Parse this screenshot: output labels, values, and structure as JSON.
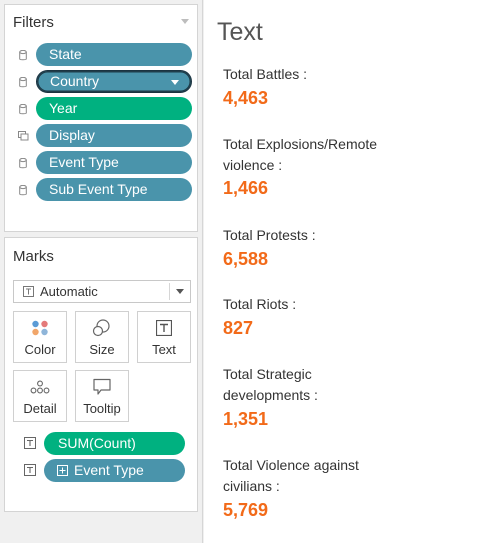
{
  "filters": {
    "title": "Filters",
    "items": [
      {
        "label": "State",
        "color": "blue",
        "icon": "database-icon"
      },
      {
        "label": "Country",
        "color": "blue",
        "icon": "database-icon",
        "selected": true
      },
      {
        "label": "Year",
        "color": "green",
        "icon": "database-icon"
      },
      {
        "label": "Display",
        "color": "blue",
        "icon": "set-icon"
      },
      {
        "label": "Event Type",
        "color": "blue",
        "icon": "database-icon"
      },
      {
        "label": "Sub Event Type",
        "color": "blue",
        "icon": "database-icon"
      }
    ]
  },
  "marks": {
    "title": "Marks",
    "mark_type": "Automatic",
    "buttons": [
      {
        "label": "Color",
        "icon": "color-dots-icon"
      },
      {
        "label": "Size",
        "icon": "size-circles-icon"
      },
      {
        "label": "Text",
        "icon": "text-box-icon"
      },
      {
        "label": "Detail",
        "icon": "detail-dots-icon"
      },
      {
        "label": "Tooltip",
        "icon": "tooltip-bubble-icon"
      }
    ],
    "shelf": [
      {
        "label": "SUM(Count)",
        "color": "green",
        "icon": "text-box-icon"
      },
      {
        "label": "Event Type",
        "color": "blue",
        "icon": "text-box-icon",
        "expandable": true
      }
    ]
  },
  "sheet": {
    "title": "Text",
    "stats": [
      {
        "label": "Total Battles :",
        "value": "4,463"
      },
      {
        "label": "Total Explosions/Remote violence :",
        "value": "1,466"
      },
      {
        "label": "Total Protests :",
        "value": "6,588"
      },
      {
        "label": "Total Riots :",
        "value": "827"
      },
      {
        "label": "Total Strategic developments :",
        "value": "1,351"
      },
      {
        "label": "Total Violence against civilians :",
        "value": "5,769"
      }
    ]
  },
  "colors": {
    "pill_blue": "#4a94ab",
    "pill_green": "#00b180",
    "value_orange": "#f26a19"
  }
}
